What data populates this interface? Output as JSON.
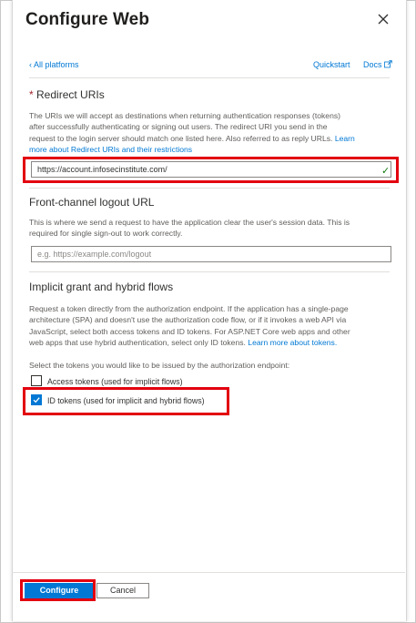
{
  "panel": {
    "title": "Configure Web",
    "back_link": "All platforms",
    "quickstart": "Quickstart",
    "docs": "Docs"
  },
  "redirect": {
    "required_mark": "*",
    "title": "Redirect URIs",
    "desc_1": "The URIs we will accept as destinations when returning authentication responses (tokens)",
    "desc_2": "after successfully authenticating or signing out users. The redirect URI you send in the",
    "desc_3": "request to the login server should match one listed here. Also referred to as reply URLs.",
    "learn_more": "Learn more about Redirect URIs and their restrictions",
    "learn_more_1": "Learn",
    "learn_more_2": "more about Redirect URIs and their restrictions",
    "value": "https://account.infosecinstitute.com/"
  },
  "logout": {
    "title": "Front-channel logout URL",
    "desc_1": "This is where we send a request to have the application clear the user's session data. This is",
    "desc_2": "required for single sign-out to work correctly.",
    "placeholder": "e.g. https://example.com/logout"
  },
  "implicit": {
    "title": "Implicit grant and hybrid flows",
    "desc_1": "Request a token directly from the authorization endpoint. If the application has a single-page",
    "desc_2": "architecture (SPA) and doesn't use the authorization code flow, or if it invokes a web API via",
    "desc_3": "JavaScript, select both access tokens and ID tokens. For ASP.NET Core web apps and other",
    "desc_4": "web apps that use hybrid authentication, select only ID tokens.",
    "learn_more": "Learn more about tokens.",
    "select_prompt": "Select the tokens you would like to be issued by the authorization endpoint:",
    "access_tokens": {
      "label": "Access tokens (used for implicit flows)",
      "checked": false
    },
    "id_tokens": {
      "label": "ID tokens (used for implicit and hybrid flows)",
      "checked": true
    }
  },
  "footer": {
    "configure": "Configure",
    "cancel": "Cancel"
  },
  "colors": {
    "accent": "#0078d4",
    "highlight": "#e3000f",
    "valid": "#107c10"
  }
}
